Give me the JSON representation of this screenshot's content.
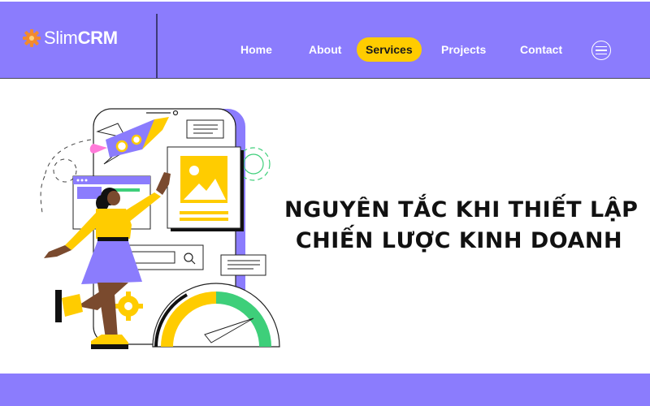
{
  "brand": {
    "name_light": "Slim",
    "name_bold": "CRM",
    "icon": "gear-icon",
    "icon_color": "#f28a2e"
  },
  "nav": {
    "items": [
      {
        "label": "Home",
        "active": false
      },
      {
        "label": "About",
        "active": false
      },
      {
        "label": "Services",
        "active": true
      },
      {
        "label": "Projects",
        "active": false
      },
      {
        "label": "Contact",
        "active": false
      }
    ],
    "menu_icon": "hamburger-menu-icon"
  },
  "hero": {
    "title_line1": "NGUYÊN TẮC KHI THIẾT LẬP",
    "title_line2": "CHIẾN LƯỢC KINH DOANH",
    "illustration": "woman-with-phone-rocket-gauge-illustration"
  },
  "colors": {
    "primary": "#8b7cfd",
    "accent": "#ffcc00",
    "text_dark": "#111111",
    "green": "#3ecf7a",
    "pink": "#ff7ad9"
  }
}
